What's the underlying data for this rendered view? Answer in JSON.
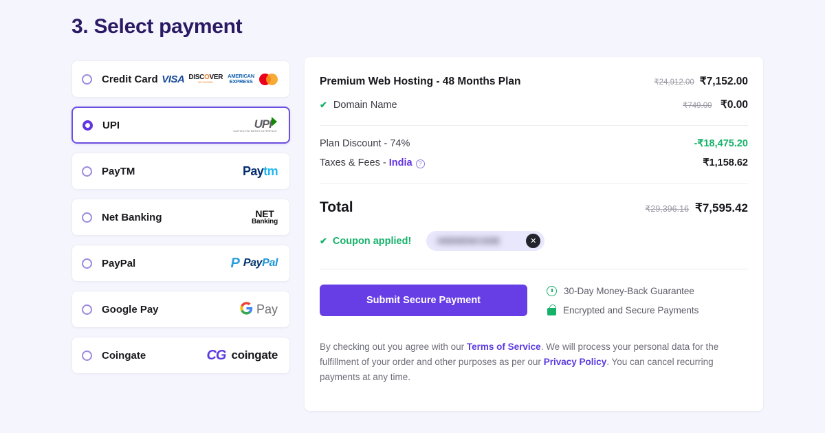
{
  "page": {
    "title": "3. Select payment"
  },
  "payment_methods": [
    {
      "label": "Credit Card",
      "selected": false,
      "logo": "card-brands-logo"
    },
    {
      "label": "UPI",
      "selected": true,
      "logo": "upi-logo"
    },
    {
      "label": "PayTM",
      "selected": false,
      "logo": "paytm-logo"
    },
    {
      "label": "Net Banking",
      "selected": false,
      "logo": "netbanking-logo"
    },
    {
      "label": "PayPal",
      "selected": false,
      "logo": "paypal-logo"
    },
    {
      "label": "Google Pay",
      "selected": false,
      "logo": "googlepay-logo"
    },
    {
      "label": "Coingate",
      "selected": false,
      "logo": "coingate-logo"
    }
  ],
  "card_brands": {
    "visa": "VISA",
    "discover": "DISC",
    "discover_o": "O",
    "discover_ver": "VER",
    "discover_sub": "NETWORK",
    "amex_line1": "AMERICAN",
    "amex_line2": "EXPRESS"
  },
  "upi_logo": {
    "mark": "UPI",
    "sub": "UNIFIED PAYMENTS INTERFACE"
  },
  "paytm_logo": {
    "part1": "Pay",
    "part2": "tm"
  },
  "netbanking_logo": {
    "line1": "NET",
    "line2": "Banking"
  },
  "paypal_logo": {
    "mark1": "P",
    "mark2": "P",
    "text1": "Pay",
    "text2": "Pal"
  },
  "googlepay_logo": {
    "g": "G",
    "text": "Pay"
  },
  "coingate_logo": {
    "mark": "CG",
    "text": "coingate"
  },
  "summary": {
    "plan": {
      "name": "Premium Web Hosting - 48 Months Plan",
      "old_price": "₹24,912.00",
      "price": "₹7,152.00"
    },
    "addon": {
      "name": "Domain Name",
      "old_price": "₹749.00",
      "price": "₹0.00",
      "check": "✔"
    },
    "discount": {
      "label": "Plan Discount - 74%",
      "value": "-₹18,475.20"
    },
    "taxes": {
      "label_prefix": "Taxes & Fees - ",
      "country": "India",
      "help_icon": "?",
      "value": "₹1,158.62"
    },
    "total": {
      "label": "Total",
      "old_price": "₹29,396.16",
      "price": "₹7,595.42"
    },
    "coupon": {
      "check": "✔",
      "text": "Coupon applied!",
      "code": "HIDDENCODE",
      "remove_icon": "✕"
    },
    "submit_button": "Submit Secure Payment",
    "trust": [
      {
        "text": "30-Day Money-Back Guarantee",
        "icon": "clock-icon"
      },
      {
        "text": "Encrypted and Secure Payments",
        "icon": "lock-icon"
      }
    ],
    "legal": {
      "part1": "By checking out you agree with our ",
      "link1": "Terms of Service",
      "part2": ". We will process your personal data for the fulfillment of your order and other purposes as per our ",
      "link2": "Privacy Policy",
      "part3": ". You can cancel recurring payments at any time."
    }
  },
  "colors": {
    "accent": "#673de6",
    "selected_border": "#6c4ee0",
    "success": "#17b26a",
    "page_bg": "#f5f5fd",
    "title": "#2b1a63"
  }
}
